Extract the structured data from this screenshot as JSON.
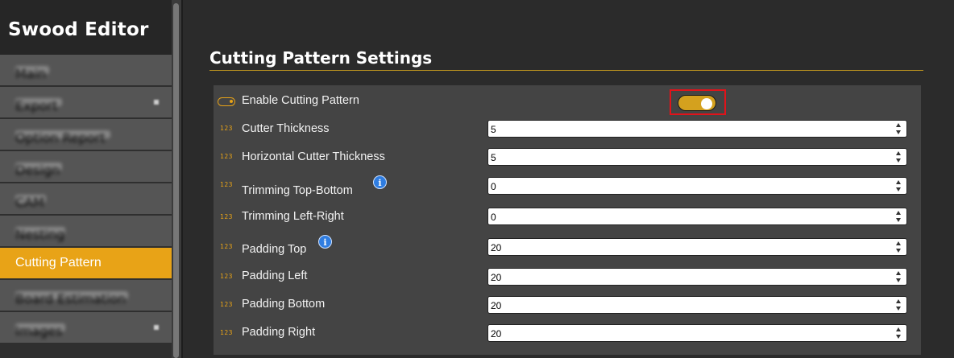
{
  "app": {
    "title": "Swood Editor"
  },
  "sidebar": {
    "items": [
      {
        "label": "Main",
        "active": false,
        "blurred": true
      },
      {
        "label": "Export",
        "active": false,
        "blurred": true,
        "has_arrow": true
      },
      {
        "label": "Option Report",
        "active": false,
        "blurred": true
      },
      {
        "label": "Design",
        "active": false,
        "blurred": true
      },
      {
        "label": "CAM",
        "active": false,
        "blurred": true
      },
      {
        "label": "Nesting",
        "active": false,
        "blurred": true
      },
      {
        "label": "Cutting Pattern",
        "active": true,
        "blurred": false
      },
      {
        "label": "Board Estimation",
        "active": false,
        "blurred": true
      },
      {
        "label": "Images",
        "active": false,
        "blurred": true,
        "has_arrow": true
      }
    ]
  },
  "main": {
    "section_title": "Cutting Pattern Settings",
    "enable": {
      "label": "Enable Cutting Pattern",
      "value": true
    },
    "fields": [
      {
        "icon": "123",
        "label": "Cutter Thickness",
        "value": "5",
        "info": false
      },
      {
        "icon": "123",
        "label": "Horizontal Cutter Thickness",
        "value": "5",
        "info": false
      },
      {
        "icon": "123",
        "label": "Trimming Top-Bottom",
        "value": "0",
        "info": true
      },
      {
        "icon": "123",
        "label": "Trimming Left-Right",
        "value": "0",
        "info": false
      },
      {
        "icon": "123",
        "label": "Padding Top",
        "value": "20",
        "info": true
      },
      {
        "icon": "123",
        "label": "Padding Left",
        "value": "20",
        "info": false
      },
      {
        "icon": "123",
        "label": "Padding Bottom",
        "value": "20",
        "info": false
      },
      {
        "icon": "123",
        "label": "Padding Right",
        "value": "20",
        "info": false
      }
    ]
  },
  "colors": {
    "accent": "#e8a317",
    "toggle_on": "#d4a11e",
    "highlight": "#e0131a",
    "info": "#2f7de1"
  }
}
